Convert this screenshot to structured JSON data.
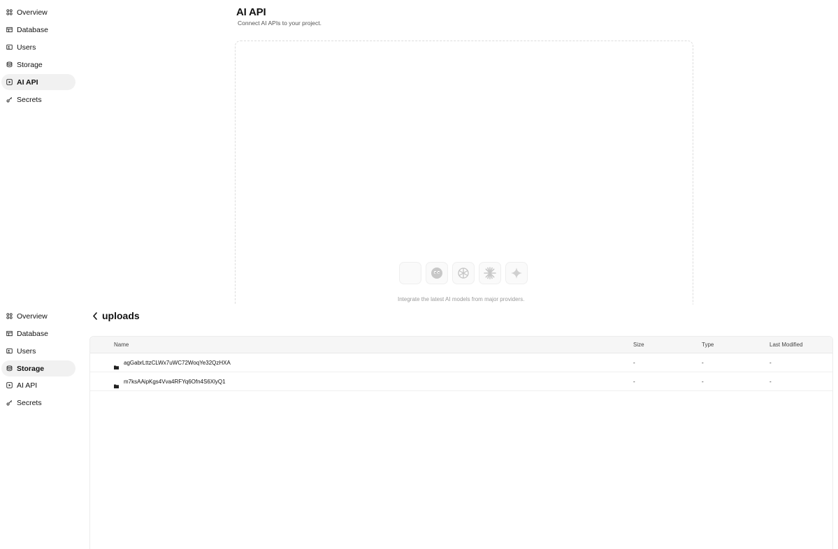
{
  "sidebar_top": {
    "items": [
      {
        "label": "Overview",
        "icon": "grid-icon"
      },
      {
        "label": "Database",
        "icon": "table-icon"
      },
      {
        "label": "Users",
        "icon": "users-icon"
      },
      {
        "label": "Storage",
        "icon": "storage-icon"
      },
      {
        "label": "AI API",
        "icon": "ai-icon"
      },
      {
        "label": "Secrets",
        "icon": "key-icon"
      }
    ],
    "active": "AI API"
  },
  "ai_api": {
    "title": "AI API",
    "subtitle": "Connect AI APIs to your project.",
    "providers": [
      "moon-provider-icon",
      "ghost-provider-icon",
      "openai-provider-icon",
      "asterisk-provider-icon",
      "sparkle-provider-icon"
    ],
    "integrate_text": "Integrate the latest AI models from major providers."
  },
  "sidebar_bottom": {
    "items": [
      {
        "label": "Overview",
        "icon": "grid-icon"
      },
      {
        "label": "Database",
        "icon": "table-icon"
      },
      {
        "label": "Users",
        "icon": "users-icon"
      },
      {
        "label": "Storage",
        "icon": "storage-icon"
      },
      {
        "label": "AI API",
        "icon": "ai-icon"
      },
      {
        "label": "Secrets",
        "icon": "key-icon"
      }
    ],
    "active": "Storage"
  },
  "storage": {
    "folder_title": "uploads",
    "columns": [
      "Name",
      "Size",
      "Type",
      "Last Modified"
    ],
    "rows": [
      {
        "name": "agGabrLttzCLWx7uWC72WoqYe32QzHXA",
        "size": "-",
        "type": "-",
        "modified": "-"
      },
      {
        "name": "m7ksAAipKgs4Vva4RFYq6Ofn4S6XlyQ1",
        "size": "-",
        "type": "-",
        "modified": "-"
      }
    ]
  },
  "colors": {
    "active_bg": "#f1f1f1",
    "table_header_bg": "#f6f6f6",
    "muted_text": "#9a9a9a"
  }
}
